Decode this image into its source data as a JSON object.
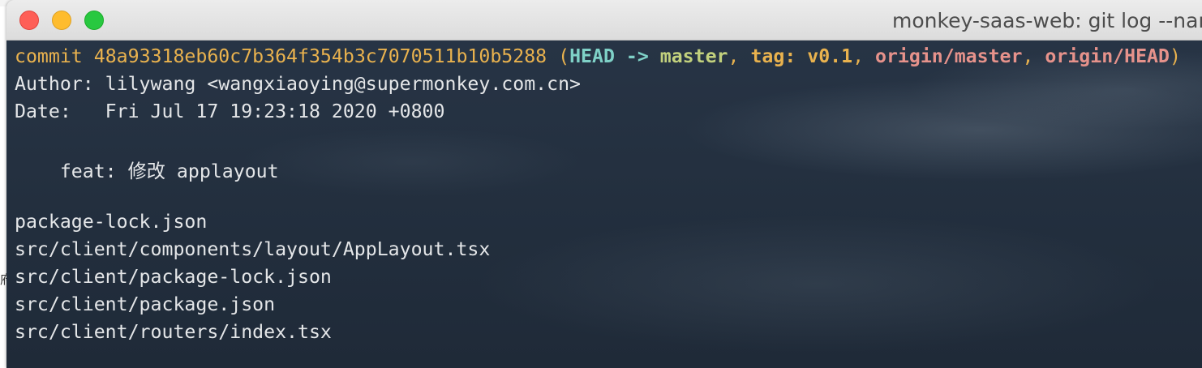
{
  "window": {
    "title": "monkey-saas-web: git log --nar"
  },
  "backdrop": {
    "edge_glyph": "府"
  },
  "commit": {
    "label": "commit ",
    "hash": "48a93318eb60c7b364f354b3c7070511b10b5288",
    "refs_open": " (",
    "head": "HEAD",
    "arrow": " -> ",
    "branch": "master",
    "sep1": ", ",
    "tag": "tag: v0.1",
    "sep2": ", ",
    "origin_master": "origin/master",
    "sep3": ", ",
    "origin_head": "origin/HEAD",
    "refs_close": ")"
  },
  "author_line": "Author: lilywang <wangxiaoying@supermonkey.com.cn>",
  "date_line": "Date:   Fri Jul 17 19:23:18 2020 +0800",
  "message": "    feat: 修改 applayout",
  "files": [
    "package-lock.json",
    "src/client/components/layout/AppLayout.tsx",
    "src/client/package-lock.json",
    "src/client/package.json",
    "src/client/routers/index.tsx"
  ],
  "colors": {
    "commit": "#e9b24e",
    "head": "#7fd1c7",
    "branch": "#c2d17d",
    "origin": "#e6928b",
    "text": "#e4e6e8",
    "background": "#253242"
  }
}
